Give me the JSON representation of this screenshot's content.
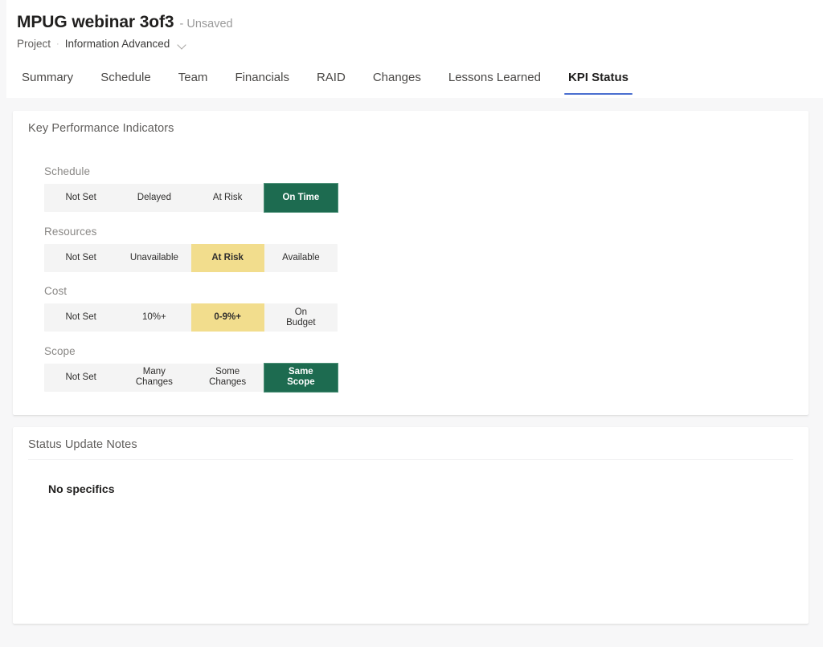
{
  "header": {
    "doc_title": "MPUG webinar 3of3",
    "doc_state": "- Unsaved",
    "breadcrumb": {
      "root": "Project",
      "separator": "·",
      "current": "Information Advanced",
      "chevron_icon": "chevron-down-icon"
    }
  },
  "tabs": [
    {
      "label": "Summary",
      "active": false
    },
    {
      "label": "Schedule",
      "active": false
    },
    {
      "label": "Team",
      "active": false
    },
    {
      "label": "Financials",
      "active": false
    },
    {
      "label": "RAID",
      "active": false
    },
    {
      "label": "Changes",
      "active": false
    },
    {
      "label": "Lessons Learned",
      "active": false
    },
    {
      "label": "KPI Status",
      "active": true
    }
  ],
  "kpi_card": {
    "title": "Key Performance Indicators",
    "groups": [
      {
        "label": "Schedule",
        "options": [
          {
            "label": "Not Set",
            "state": "none"
          },
          {
            "label": "Delayed",
            "state": "none"
          },
          {
            "label": "At Risk",
            "state": "none"
          },
          {
            "label": "On Time",
            "state": "green"
          }
        ],
        "selected": "On Time"
      },
      {
        "label": "Resources",
        "options": [
          {
            "label": "Not Set",
            "state": "none"
          },
          {
            "label": "Unavailable",
            "state": "none"
          },
          {
            "label": "At Risk",
            "state": "yellow"
          },
          {
            "label": "Available",
            "state": "none"
          }
        ],
        "selected": "At Risk"
      },
      {
        "label": "Cost",
        "options": [
          {
            "label": "Not Set",
            "state": "none"
          },
          {
            "label": "10%+",
            "state": "none"
          },
          {
            "label": "0-9%+",
            "state": "yellow"
          },
          {
            "label": "On\nBudget",
            "state": "none"
          }
        ],
        "selected": "0-9%+"
      },
      {
        "label": "Scope",
        "options": [
          {
            "label": "Not Set",
            "state": "none"
          },
          {
            "label": "Many\nChanges",
            "state": "none"
          },
          {
            "label": "Some\nChanges",
            "state": "none"
          },
          {
            "label": "Same\nScope",
            "state": "green"
          }
        ],
        "selected": "Same Scope"
      }
    ]
  },
  "notes_card": {
    "title": "Status Update Notes",
    "body": "No specifics"
  },
  "colors": {
    "selected_green": "#1d6b50",
    "selected_yellow": "#f2dd8d",
    "track_background": "#f4f4f4",
    "active_tab_underline": "#4a6fd0",
    "page_background": "#f7f7f8",
    "card_background": "#ffffff"
  }
}
